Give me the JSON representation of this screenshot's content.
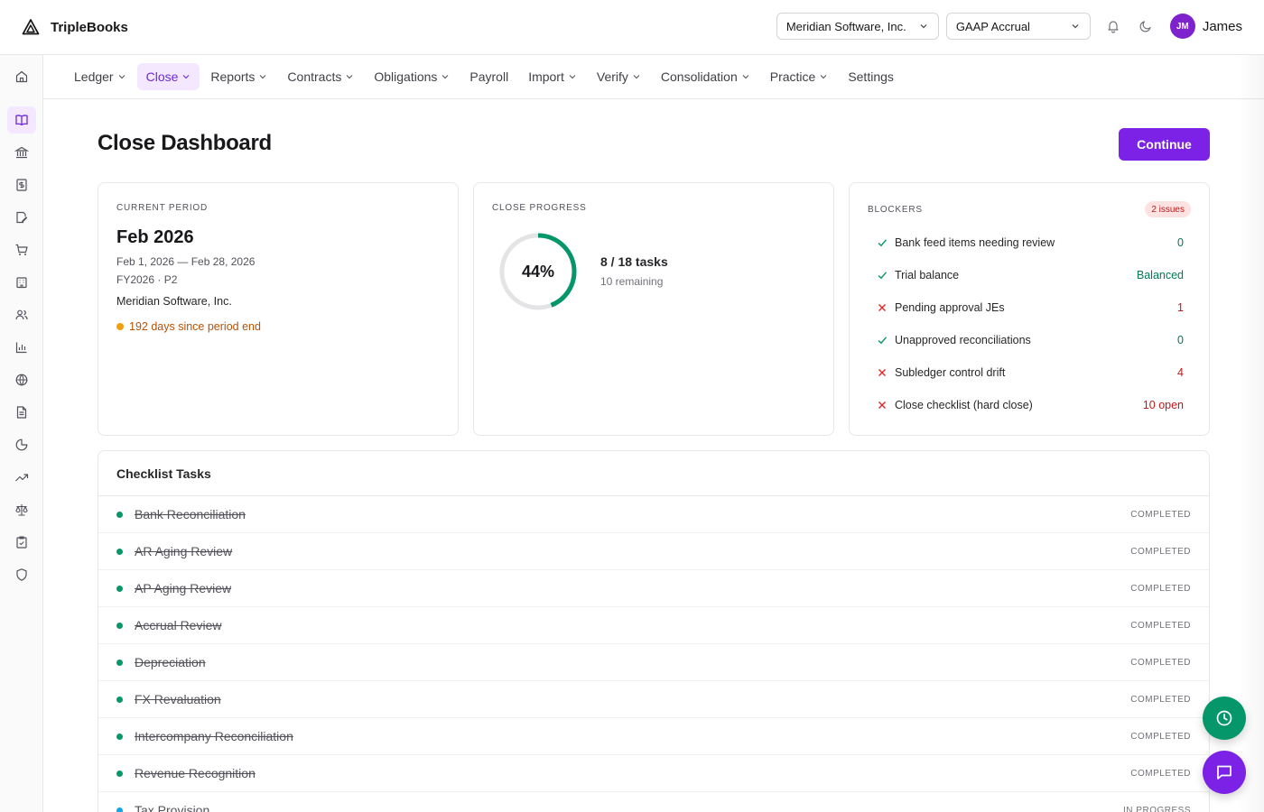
{
  "app": {
    "name": "TripleBooks"
  },
  "header": {
    "company": "Meridian Software, Inc.",
    "basis": "GAAP Accrual",
    "user_initials": "JM",
    "user_name": "James"
  },
  "rail": {
    "icons": [
      "home-icon",
      "book-icon",
      "bank-icon",
      "dollar-doc-icon",
      "edit-doc-icon",
      "cart-icon",
      "building-icon",
      "users-icon",
      "bar-chart-icon",
      "globe-icon",
      "document-icon",
      "pie-chart-icon",
      "trend-up-icon",
      "scale-icon",
      "clipboard-check-icon",
      "shield-icon"
    ],
    "active_index": 1
  },
  "nav": {
    "items": [
      {
        "label": "Ledger",
        "has_menu": true
      },
      {
        "label": "Close",
        "has_menu": true,
        "active": true
      },
      {
        "label": "Reports",
        "has_menu": true
      },
      {
        "label": "Contracts",
        "has_menu": true
      },
      {
        "label": "Obligations",
        "has_menu": true
      },
      {
        "label": "Payroll",
        "has_menu": false
      },
      {
        "label": "Import",
        "has_menu": true
      },
      {
        "label": "Verify",
        "has_menu": true
      },
      {
        "label": "Consolidation",
        "has_menu": true
      },
      {
        "label": "Practice",
        "has_menu": true
      },
      {
        "label": "Settings",
        "has_menu": false
      }
    ]
  },
  "page": {
    "title": "Close Dashboard",
    "primary_action": "Continue"
  },
  "period": {
    "label": "CURRENT PERIOD",
    "name": "Feb 2026",
    "range": "Feb 1, 2026 — Feb 28, 2026",
    "fiscal": "FY2026 · P2",
    "company": "Meridian Software, Inc.",
    "warning": "192 days since period end"
  },
  "progress": {
    "label": "CLOSE PROGRESS",
    "percent_label": "44%",
    "fraction": 0.44,
    "tasks": "8 / 18 tasks",
    "remaining": "10 remaining",
    "color": "#059669"
  },
  "blockers": {
    "label": "BLOCKERS",
    "badge": "2 issues",
    "items": [
      {
        "label": "Bank feed items needing review",
        "value": "0",
        "ok": true
      },
      {
        "label": "Trial balance",
        "value": "Balanced",
        "ok": true
      },
      {
        "label": "Pending approval JEs",
        "value": "1",
        "ok": false
      },
      {
        "label": "Unapproved reconciliations",
        "value": "0",
        "ok": true
      },
      {
        "label": "Subledger control drift",
        "value": "4",
        "ok": false
      },
      {
        "label": "Close checklist (hard close)",
        "value": "10 open",
        "ok": false
      }
    ]
  },
  "checklist": {
    "title": "Checklist Tasks",
    "tasks": [
      {
        "name": "Bank Reconciliation",
        "status": "COMPLETED",
        "done": true,
        "color": "#059669"
      },
      {
        "name": "AR Aging Review",
        "status": "COMPLETED",
        "done": true,
        "color": "#059669"
      },
      {
        "name": "AP Aging Review",
        "status": "COMPLETED",
        "done": true,
        "color": "#059669"
      },
      {
        "name": "Accrual Review",
        "status": "COMPLETED",
        "done": true,
        "color": "#059669"
      },
      {
        "name": "Depreciation",
        "status": "COMPLETED",
        "done": true,
        "color": "#059669"
      },
      {
        "name": "FX Revaluation",
        "status": "COMPLETED",
        "done": true,
        "color": "#059669"
      },
      {
        "name": "Intercompany Reconciliation",
        "status": "COMPLETED",
        "done": true,
        "color": "#059669"
      },
      {
        "name": "Revenue Recognition",
        "status": "COMPLETED",
        "done": true,
        "color": "#059669"
      },
      {
        "name": "Tax Provision",
        "status": "IN PROGRESS",
        "done": false,
        "color": "#0ea5e9"
      }
    ]
  },
  "colors": {
    "accent": "#7c22e6",
    "success": "#059669",
    "danger": "#b91c1c",
    "warning": "#f59e0b"
  }
}
